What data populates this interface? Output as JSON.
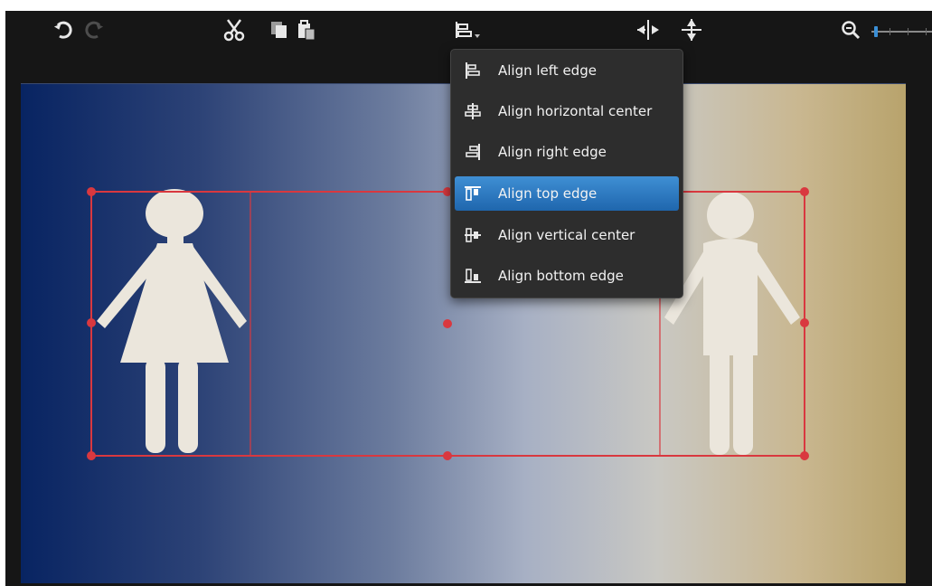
{
  "toolbar": {
    "undo_icon": "undo-icon",
    "redo_icon": "redo-icon",
    "cut_icon": "scissors-icon",
    "copy_icon": "copy-icon",
    "paste_icon": "paste-icon",
    "align_icon": "align-left-dropdown-icon",
    "distribute_h_icon": "distribute-horizontal-icon",
    "distribute_v_icon": "distribute-vertical-icon",
    "zoom_icon": "zoom-out-icon",
    "zoom_level": 0.05
  },
  "align_menu": {
    "selected_index": 3,
    "items": [
      {
        "label": "Align left edge",
        "icon": "align-left-edge-icon"
      },
      {
        "label": "Align horizontal center",
        "icon": "align-horizontal-center-icon"
      },
      {
        "label": "Align right edge",
        "icon": "align-right-edge-icon"
      },
      {
        "label": "Align top edge",
        "icon": "align-top-edge-icon"
      },
      {
        "label": "Align vertical center",
        "icon": "align-vertical-center-icon"
      },
      {
        "label": "Align bottom edge",
        "icon": "align-bottom-edge-icon"
      }
    ]
  },
  "canvas": {
    "figures": [
      "woman-figure",
      "man-figure"
    ],
    "selection_color": "#d9383f",
    "figure_color": "#ebe6dc",
    "gradient_colors": [
      "#082462",
      "#a7b0c4",
      "#b8a36c"
    ]
  }
}
